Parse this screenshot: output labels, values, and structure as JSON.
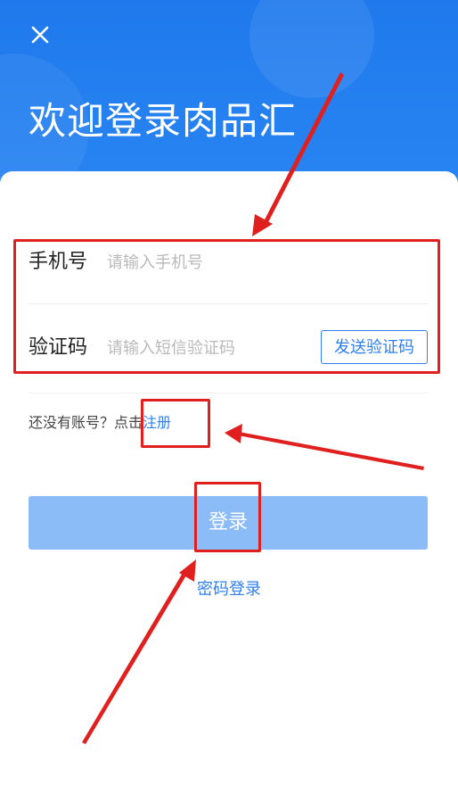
{
  "header": {
    "title": "欢迎登录肉品汇",
    "close_icon": "close-icon"
  },
  "form": {
    "phone": {
      "label": "手机号",
      "placeholder": "请输入手机号",
      "value": ""
    },
    "code": {
      "label": "验证码",
      "placeholder": "请输入短信验证码",
      "value": "",
      "send_button": "发送验证码"
    }
  },
  "register": {
    "prompt": "还没有账号？点击",
    "link": "注册"
  },
  "actions": {
    "login": "登录",
    "password_login": "密码登录"
  },
  "colors": {
    "header_blue": "#1f79ec",
    "link_blue": "#2f7ff0",
    "login_button": "#8cbcf8",
    "annotation_red": "#e0201e"
  }
}
